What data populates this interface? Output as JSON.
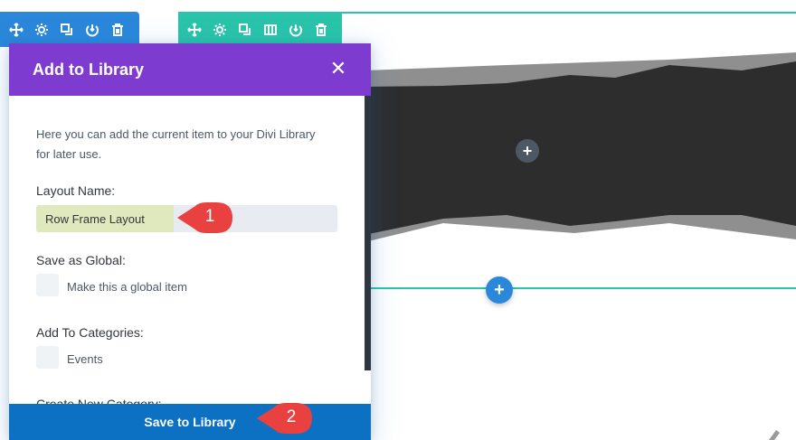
{
  "section_toolbar": {
    "color": "#2b87da",
    "icons": [
      "move-icon",
      "gear-icon",
      "duplicate-icon",
      "save-to-library-icon",
      "trash-icon"
    ]
  },
  "row_toolbar": {
    "color": "#29c4a9",
    "icons": [
      "move-icon",
      "gear-icon",
      "duplicate-icon",
      "columns-icon",
      "save-to-library-icon",
      "trash-icon"
    ]
  },
  "canvas": {
    "add_module_symbol": "+",
    "add_row_symbol": "+"
  },
  "modal": {
    "title": "Add to Library",
    "close_symbol": "✕",
    "header_color": "#7e3bd0",
    "description": "Here you can add the current item to your Divi Library for later use.",
    "layout_name_label": "Layout Name:",
    "layout_name_value": "Row Frame Layout",
    "global_label": "Save as Global:",
    "global_checkbox_label": "Make this a global item",
    "categories_label": "Add To Categories:",
    "category_events_label": "Events",
    "new_category_label": "Create New Category:",
    "save_button_label": "Save to Library",
    "save_button_color": "#0c71c3"
  },
  "callouts": [
    {
      "number": "1",
      "color": "#e8413f"
    },
    {
      "number": "2",
      "color": "#e8413f"
    }
  ]
}
